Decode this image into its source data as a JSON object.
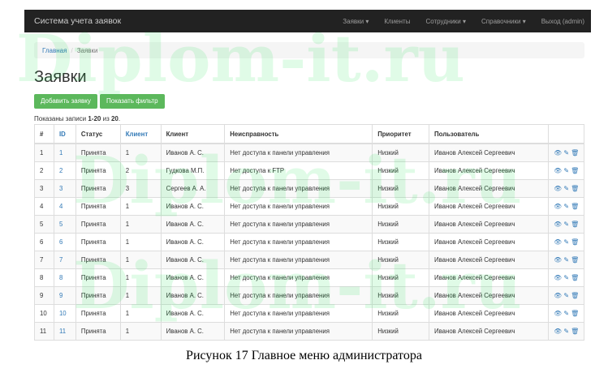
{
  "navbar": {
    "brand": "Система учета заявок",
    "items": [
      "Заявки ▾",
      "Клиенты",
      "Сотрудники ▾",
      "Справочники ▾",
      "Выход (admin)"
    ]
  },
  "breadcrumb": {
    "home": "Главная",
    "sep": "/",
    "current": "Заявки"
  },
  "page_title": "Заявки",
  "buttons": {
    "add": "Добавить заявку",
    "filter": "Показать фильтр"
  },
  "summary": {
    "prefix": "Показаны записи ",
    "range": "1-20",
    "mid": " из ",
    "total": "20",
    "suffix": "."
  },
  "table": {
    "headers": [
      "#",
      "ID",
      "Статус",
      "Клиент",
      "Клиент",
      "Неисправность",
      "Приоритет",
      "Пользователь",
      ""
    ],
    "rows": [
      [
        "1",
        "1",
        "Принята",
        "1",
        "Иванов А. С.",
        "Нет доступа к панели управления",
        "Низкий",
        "Иванов Алексей Сергеевич"
      ],
      [
        "2",
        "2",
        "Принята",
        "2",
        "Гудкова М.П.",
        "Нет доступа к FTP",
        "Низкий",
        "Иванов Алексей Сергеевич"
      ],
      [
        "3",
        "3",
        "Принята",
        "3",
        "Сергеев А. А.",
        "Нет доступа к панели управления",
        "Низкий",
        "Иванов Алексей Сергеевич"
      ],
      [
        "4",
        "4",
        "Принята",
        "1",
        "Иванов А. С.",
        "Нет доступа к панели управления",
        "Низкий",
        "Иванов Алексей Сергеевич"
      ],
      [
        "5",
        "5",
        "Принята",
        "1",
        "Иванов А. С.",
        "Нет доступа к панели управления",
        "Низкий",
        "Иванов Алексей Сергеевич"
      ],
      [
        "6",
        "6",
        "Принята",
        "1",
        "Иванов А. С.",
        "Нет доступа к панели управления",
        "Низкий",
        "Иванов Алексей Сергеевич"
      ],
      [
        "7",
        "7",
        "Принята",
        "1",
        "Иванов А. С.",
        "Нет доступа к панели управления",
        "Низкий",
        "Иванов Алексей Сергеевич"
      ],
      [
        "8",
        "8",
        "Принята",
        "1",
        "Иванов А. С.",
        "Нет доступа к панели управления",
        "Низкий",
        "Иванов Алексей Сергеевич"
      ],
      [
        "9",
        "9",
        "Принята",
        "1",
        "Иванов А. С.",
        "Нет доступа к панели управления",
        "Низкий",
        "Иванов Алексей Сергеевич"
      ],
      [
        "10",
        "10",
        "Принята",
        "1",
        "Иванов А. С.",
        "Нет доступа к панели управления",
        "Низкий",
        "Иванов Алексей Сергеевич"
      ],
      [
        "11",
        "11",
        "Принята",
        "1",
        "Иванов А. С.",
        "Нет доступа к панели управления",
        "Низкий",
        "Иванов Алексей Сергеевич"
      ]
    ]
  },
  "watermark": "Diplom-it.ru",
  "caption": "Рисунок 17 Главное меню администратора"
}
